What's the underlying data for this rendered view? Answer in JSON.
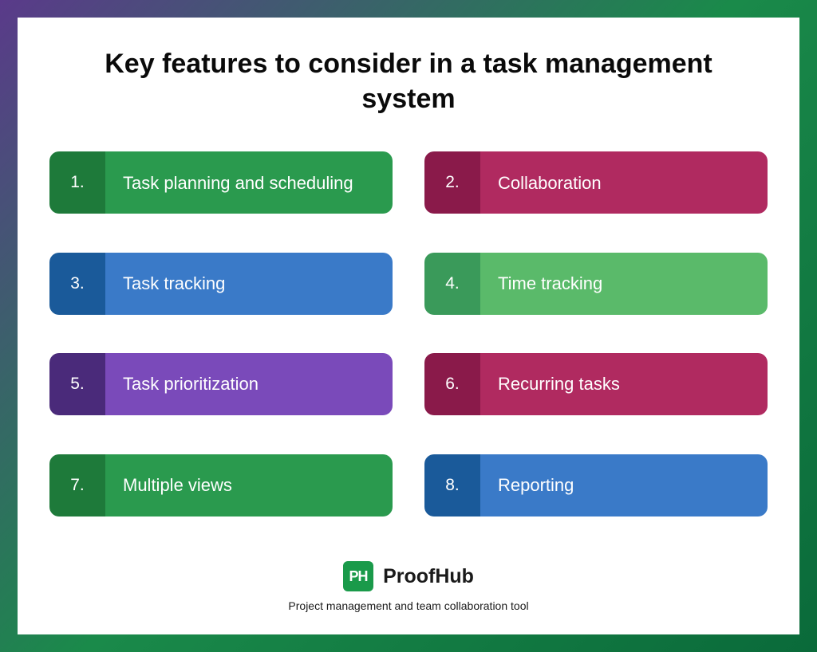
{
  "title": "Key features to consider in a task management system",
  "features": [
    {
      "num": "1.",
      "label": "Task planning and scheduling",
      "numBg": "#1e7a3a",
      "bodyBg": "#2a9a4e"
    },
    {
      "num": "2.",
      "label": "Collaboration",
      "numBg": "#8a1a4a",
      "bodyBg": "#b02a60"
    },
    {
      "num": "3.",
      "label": "Task tracking",
      "numBg": "#1a5a9a",
      "bodyBg": "#3a7ac8"
    },
    {
      "num": "4.",
      "label": "Time tracking",
      "numBg": "#3a9a5a",
      "bodyBg": "#5aba6a"
    },
    {
      "num": "5.",
      "label": "Task prioritization",
      "numBg": "#4a2a7a",
      "bodyBg": "#7a4aba"
    },
    {
      "num": "6.",
      "label": "Recurring tasks",
      "numBg": "#8a1a4a",
      "bodyBg": "#b02a60"
    },
    {
      "num": "7.",
      "label": "Multiple views",
      "numBg": "#1e7a3a",
      "bodyBg": "#2a9a4e"
    },
    {
      "num": "8.",
      "label": "Reporting",
      "numBg": "#1a5a9a",
      "bodyBg": "#3a7ac8"
    }
  ],
  "brand": {
    "logoText": "PH",
    "name": "ProofHub",
    "tagline": "Project management and team collaboration tool"
  }
}
